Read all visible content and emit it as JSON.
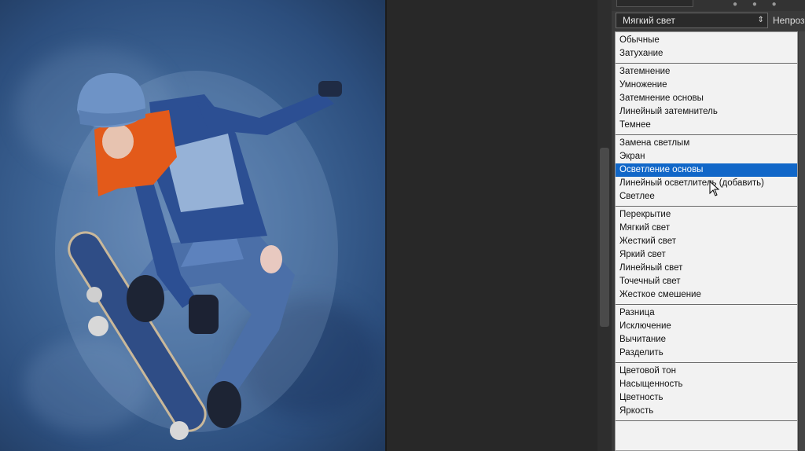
{
  "canvas": {
    "description_icon": "photo-canvas"
  },
  "layers_panel": {
    "blend_mode_value": "Мягкий свет",
    "opacity_label": "Непроз",
    "dropdown_arrow": "⇕"
  },
  "blend_menu": {
    "groups": [
      {
        "items": [
          "Обычные",
          "Затухание"
        ]
      },
      {
        "items": [
          "Затемнение",
          "Умножение",
          "Затемнение основы",
          "Линейный затемнитель",
          "Темнее"
        ]
      },
      {
        "items": [
          "Замена светлым",
          "Экран",
          "Осветление основы",
          "Линейный осветлитель (добавить)",
          "Светлее"
        ]
      },
      {
        "items": [
          "Перекрытие",
          "Мягкий свет",
          "Жесткий свет",
          "Яркий свет",
          "Линейный свет",
          "Точечный свет",
          "Жесткое смешение"
        ]
      },
      {
        "items": [
          "Разница",
          "Исключение",
          "Вычитание",
          "Разделить"
        ]
      },
      {
        "items": [
          "Цветовой тон",
          "Насыщенность",
          "Цветность",
          "Яркость"
        ]
      }
    ],
    "selected": "Осветление основы"
  },
  "colors": {
    "selection": "#1167c8",
    "panel_bg": "#3a3a3a",
    "menu_bg": "#f2f2f2"
  }
}
